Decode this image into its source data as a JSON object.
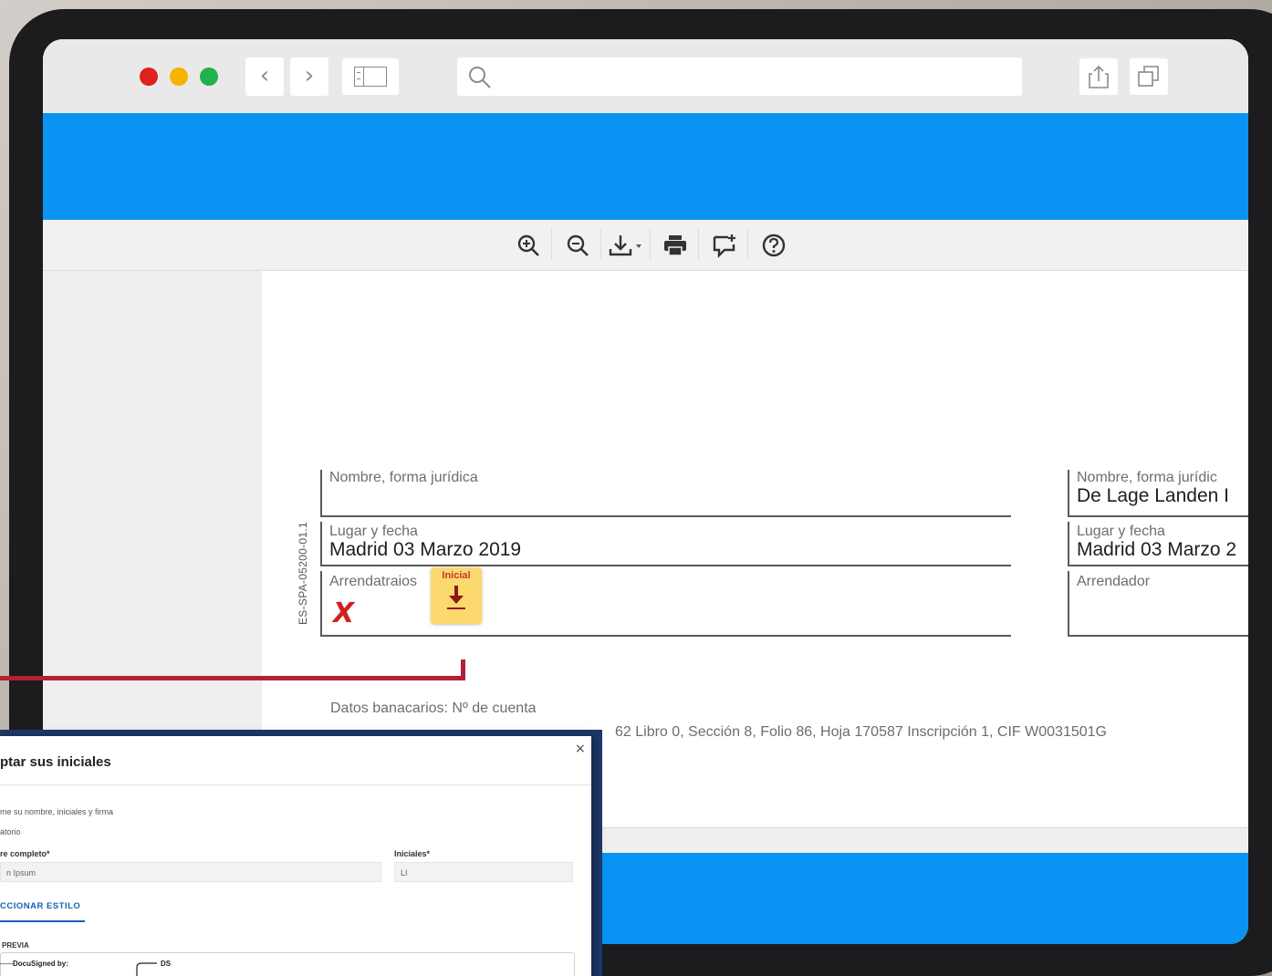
{
  "browser": {
    "back_glyph": "‹",
    "forward_glyph": "›",
    "address": "",
    "icons": [
      "search-icon",
      "share-icon",
      "tabs-icon",
      "sidebar-icon"
    ]
  },
  "viewer_toolbar": {
    "icons": [
      "zoom-in-icon",
      "zoom-out-icon",
      "download-icon",
      "print-icon",
      "comment-icon",
      "help-icon"
    ]
  },
  "document": {
    "vertical_code": "ES-SPA-05200-01.1",
    "left_block": {
      "name_label": "Nombre, forma jurídica",
      "name_value": "",
      "place_label": "Lugar y fecha",
      "place_value": "Madrid 03 Marzo 2019",
      "sign_label": "Arrendatraios",
      "sign_marker": "X",
      "initial_tag": "Inicial"
    },
    "right_block": {
      "name_label": "Nombre, forma jurídic",
      "name_value": "De Lage Landen I",
      "place_label": "Lugar y fecha",
      "place_value": "Madrid 03 Marzo 2",
      "sign_label": "Arrendador"
    },
    "bank_line": "Datos banacarios: Nº de cuenta",
    "registry_line": "62 Libro 0, Sección 8, Folio 86, Hoja 170587 Inscripción 1, CIF W0031501G"
  },
  "dialog": {
    "title": "ptar sus iniciales",
    "close": "×",
    "instructions": "me su nombre, iniciales y firma",
    "required_note": "atorio",
    "full_name_label": "re completo*",
    "full_name_value": "n Ipsum",
    "initials_label": "Iniciales*",
    "initials_value": "LI",
    "select_style": "CCIONAR ESTILO",
    "preview_label": "PREVIA",
    "docusigned_by": "DocuSigned by:",
    "ds_badge": "DS"
  },
  "colors": {
    "brand_blue": "#0a93f2",
    "callout_red": "#b22234",
    "initial_tag_yellow": "#fbd96f",
    "sign_marker_red": "#d21f1f"
  }
}
